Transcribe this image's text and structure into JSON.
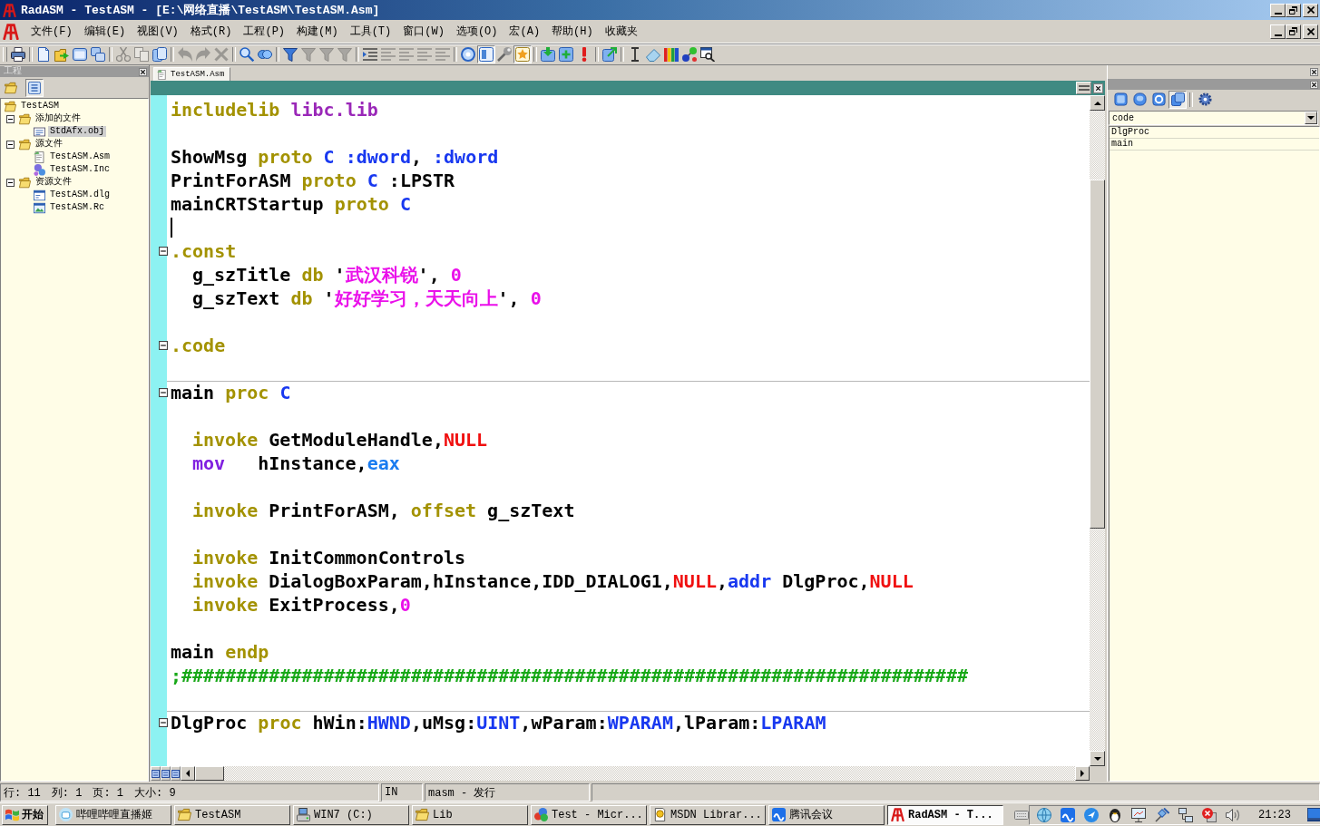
{
  "window": {
    "title": "RadASM - TestASM - [E:\\网络直播\\TestASM\\TestASM.Asm]"
  },
  "menu": [
    "文件(F)",
    "编辑(E)",
    "视图(V)",
    "格式(R)",
    "工程(P)",
    "构建(M)",
    "工具(T)",
    "窗口(W)",
    "选项(O)",
    "宏(A)",
    "帮助(H)",
    "收藏夹"
  ],
  "toolbar": [
    [
      {
        "disabled": false,
        "pressed": false
      }
    ],
    [
      {
        "disabled": false,
        "pressed": false
      },
      {
        "disabled": false,
        "pressed": false
      },
      {
        "disabled": false,
        "pressed": false
      },
      {
        "disabled": false,
        "pressed": false
      }
    ],
    [
      {
        "disabled": true,
        "pressed": false
      },
      {
        "disabled": true,
        "pressed": false
      },
      {
        "disabled": false,
        "pressed": false
      }
    ],
    [
      {
        "disabled": true,
        "pressed": false
      },
      {
        "disabled": true,
        "pressed": false
      },
      {
        "disabled": true,
        "pressed": false
      }
    ],
    [
      {
        "disabled": false,
        "pressed": false
      },
      {
        "disabled": false,
        "pressed": false
      }
    ],
    [
      {
        "disabled": false,
        "pressed": false
      },
      {
        "disabled": true,
        "pressed": false
      },
      {
        "disabled": true,
        "pressed": false
      },
      {
        "disabled": true,
        "pressed": false
      }
    ],
    [
      {
        "disabled": false,
        "pressed": false
      },
      {
        "disabled": true,
        "pressed": false
      },
      {
        "disabled": true,
        "pressed": false
      },
      {
        "disabled": true,
        "pressed": false
      },
      {
        "disabled": true,
        "pressed": false
      }
    ],
    [
      {
        "disabled": false,
        "pressed": false
      },
      {
        "disabled": false,
        "pressed": true
      },
      {
        "disabled": false,
        "pressed": false
      },
      {
        "disabled": false,
        "pressed": true
      }
    ],
    [
      {
        "disabled": false,
        "pressed": false
      },
      {
        "disabled": false,
        "pressed": false
      },
      {
        "disabled": false,
        "pressed": false
      }
    ],
    [
      {
        "disabled": false,
        "pressed": false
      }
    ],
    [
      {
        "disabled": false,
        "pressed": false
      },
      {
        "disabled": false,
        "pressed": false
      },
      {
        "disabled": false,
        "pressed": false
      },
      {
        "disabled": false,
        "pressed": false
      },
      {
        "disabled": false,
        "pressed": false
      }
    ]
  ],
  "project": {
    "title": "工程",
    "buttons": [
      {
        "pressed": false
      },
      {
        "pressed": true
      }
    ],
    "tree": [
      {
        "label": "TestASM",
        "kind": "folder",
        "selected": false,
        "children": [
          {
            "label": "添加的文件",
            "kind": "folder",
            "expanded": true,
            "selected": false,
            "children": [
              {
                "label": "StdAfx.obj",
                "kind": "obj",
                "selected": true
              }
            ]
          },
          {
            "label": "源文件",
            "kind": "folder",
            "expanded": true,
            "selected": false,
            "children": [
              {
                "label": "TestASM.Asm",
                "kind": "asm",
                "selected": false
              },
              {
                "label": "TestASM.Inc",
                "kind": "inc",
                "selected": false
              }
            ]
          },
          {
            "label": "资源文件",
            "kind": "folder",
            "expanded": true,
            "selected": false,
            "children": [
              {
                "label": "TestASM.dlg",
                "kind": "dlg",
                "selected": false
              },
              {
                "label": "TestASM.Rc",
                "kind": "rc",
                "selected": false
              }
            ]
          }
        ]
      }
    ]
  },
  "editor": {
    "tabs": [
      {
        "label": "TestASM.Asm",
        "selected": true
      }
    ],
    "paragraphs": [
      [
        {
          "kind": "header",
          "tokens": [
            {
              "text": "includelib ",
              "kind": "keyword"
            },
            {
              "text": "libc.lib",
              "kind": "library"
            }
          ]
        }
      ],
      [
        {
          "kind": "header",
          "tokens": [
            {
              "text": "ShowMsg ",
              "kind": "plain"
            },
            {
              "text": "proto ",
              "kind": "keyword"
            },
            {
              "text": "C ",
              "kind": "type"
            },
            {
              "text": ":dword",
              "kind": "type"
            },
            {
              "text": ", ",
              "kind": "plain"
            },
            {
              "text": ":dword",
              "kind": "type"
            }
          ]
        },
        {
          "kind": "header",
          "tokens": [
            {
              "text": "PrintForASM ",
              "kind": "plain"
            },
            {
              "text": "proto ",
              "kind": "keyword"
            },
            {
              "text": "C",
              "kind": "type"
            },
            {
              "text": " :LPSTR",
              "kind": "plain"
            }
          ]
        },
        {
          "kind": "header",
          "tokens": [
            {
              "text": "mainCRTStartup ",
              "kind": "plain"
            },
            {
              "text": "proto ",
              "kind": "keyword"
            },
            {
              "text": "C",
              "kind": "type"
            }
          ]
        },
        {
          "caret": true
        },
        {
          "kind": "header",
          "collapsed": false,
          "tokens": [
            {
              "text": ".const",
              "kind": "keyword"
            }
          ]
        },
        {
          "kind": "body",
          "tokens": [
            {
              "text": "g_szTitle ",
              "kind": "plain"
            },
            {
              "text": "db",
              "kind": "keyword"
            },
            {
              "text": " '",
              "kind": "plain"
            },
            {
              "text": "武汉科锐",
              "kind": "string"
            },
            {
              "text": "', ",
              "kind": "plain"
            },
            {
              "text": "0",
              "kind": "number"
            }
          ]
        },
        {
          "kind": "body",
          "tokens": [
            {
              "text": "g_szText ",
              "kind": "plain"
            },
            {
              "text": "db",
              "kind": "keyword"
            },
            {
              "text": " '",
              "kind": "plain"
            },
            {
              "text": "好好学习，天天向上",
              "kind": "string"
            },
            {
              "text": "', ",
              "kind": "plain"
            },
            {
              "text": "0",
              "kind": "number"
            }
          ]
        }
      ],
      [
        {
          "kind": "header",
          "collapsed": false,
          "tokens": [
            {
              "text": ".code",
              "kind": "keyword"
            }
          ]
        }
      ],
      [
        {
          "kind": "header",
          "collapsed": false,
          "divider": true,
          "tokens": [
            {
              "text": "main ",
              "kind": "plain"
            },
            {
              "text": "proc ",
              "kind": "keyword"
            },
            {
              "text": "C",
              "kind": "type"
            }
          ]
        }
      ],
      [
        {
          "kind": "body",
          "tokens": [
            {
              "text": "invoke",
              "kind": "keyword"
            },
            {
              "text": " GetModuleHandle,",
              "kind": "plain"
            },
            {
              "text": "NULL",
              "kind": "constant"
            }
          ]
        },
        {
          "kind": "body",
          "tokens": [
            {
              "text": "mov",
              "kind": "instruction"
            },
            {
              "text": "   hInstance,",
              "kind": "plain"
            },
            {
              "text": "eax",
              "kind": "register"
            }
          ]
        }
      ],
      [
        {
          "kind": "body",
          "tokens": [
            {
              "text": "invoke",
              "kind": "keyword"
            },
            {
              "text": " PrintForASM, ",
              "kind": "plain"
            },
            {
              "text": "offset",
              "kind": "keyword"
            },
            {
              "text": " g_szText",
              "kind": "plain"
            }
          ]
        }
      ],
      [
        {
          "kind": "body",
          "tokens": [
            {
              "text": "invoke",
              "kind": "keyword"
            },
            {
              "text": " InitCommonControls",
              "kind": "plain"
            }
          ]
        },
        {
          "kind": "body",
          "tokens": [
            {
              "text": "invoke",
              "kind": "keyword"
            },
            {
              "text": " DialogBoxParam,hInstance,IDD_DIALOG1,",
              "kind": "plain"
            },
            {
              "text": "NULL",
              "kind": "constant"
            },
            {
              "text": ",",
              "kind": "plain"
            },
            {
              "text": "addr",
              "kind": "type"
            },
            {
              "text": " DlgProc,",
              "kind": "plain"
            },
            {
              "text": "NULL",
              "kind": "constant"
            }
          ]
        },
        {
          "kind": "body",
          "tokens": [
            {
              "text": "invoke",
              "kind": "keyword"
            },
            {
              "text": " ExitProcess,",
              "kind": "plain"
            },
            {
              "text": "0",
              "kind": "number"
            }
          ]
        }
      ],
      [
        {
          "kind": "header",
          "tokens": [
            {
              "text": "main ",
              "kind": "plain"
            },
            {
              "text": "endp",
              "kind": "keyword"
            }
          ]
        },
        {
          "kind": "header",
          "tokens": [
            {
              "text": ";########################################################################",
              "kind": "comment"
            }
          ]
        }
      ],
      [
        {
          "kind": "header",
          "collapsed": false,
          "divider": true,
          "tokens": [
            {
              "text": "DlgProc ",
              "kind": "plain"
            },
            {
              "text": "proc",
              "kind": "keyword"
            },
            {
              "text": " hWin:",
              "kind": "plain"
            },
            {
              "text": "HWND",
              "kind": "type"
            },
            {
              "text": ",uMsg:",
              "kind": "plain"
            },
            {
              "text": "UINT",
              "kind": "type"
            },
            {
              "text": ",wParam:",
              "kind": "plain"
            },
            {
              "text": "WPARAM",
              "kind": "type"
            },
            {
              "text": ",lParam:",
              "kind": "plain"
            },
            {
              "text": "LPARAM",
              "kind": "type"
            }
          ]
        }
      ]
    ]
  },
  "properties": {
    "buttons": [
      {
        "pressed": false
      },
      {
        "pressed": false
      },
      {
        "pressed": false
      },
      {
        "pressed": true
      },
      {
        "pressed": false
      }
    ],
    "combo": "code",
    "items": [
      "DlgProc",
      "main"
    ]
  },
  "status_bar": {
    "fields": [
      "行: 11",
      "列: 1",
      "页: 1",
      "大小: 9"
    ],
    "mode": "IN",
    "build": "masm - 发行"
  },
  "taskbar": {
    "start": "开始",
    "tasks": [
      {
        "label": "哔哩哔哩直播姬",
        "kind": "live",
        "selected": false
      },
      {
        "label": "TestASM",
        "kind": "folder",
        "selected": false
      },
      {
        "label": "WIN7 (C:)",
        "kind": "drive",
        "selected": false
      },
      {
        "label": "Lib",
        "kind": "folder",
        "selected": false
      },
      {
        "label": "Test - Micr...",
        "kind": "office",
        "selected": false
      },
      {
        "label": "MSDN Librar...",
        "kind": "help",
        "selected": false
      },
      {
        "label": "腾讯会议",
        "kind": "meeting",
        "selected": false
      },
      {
        "label": "RadASM - T...",
        "kind": "radasm",
        "selected": true
      }
    ],
    "clock": "21:23"
  }
}
